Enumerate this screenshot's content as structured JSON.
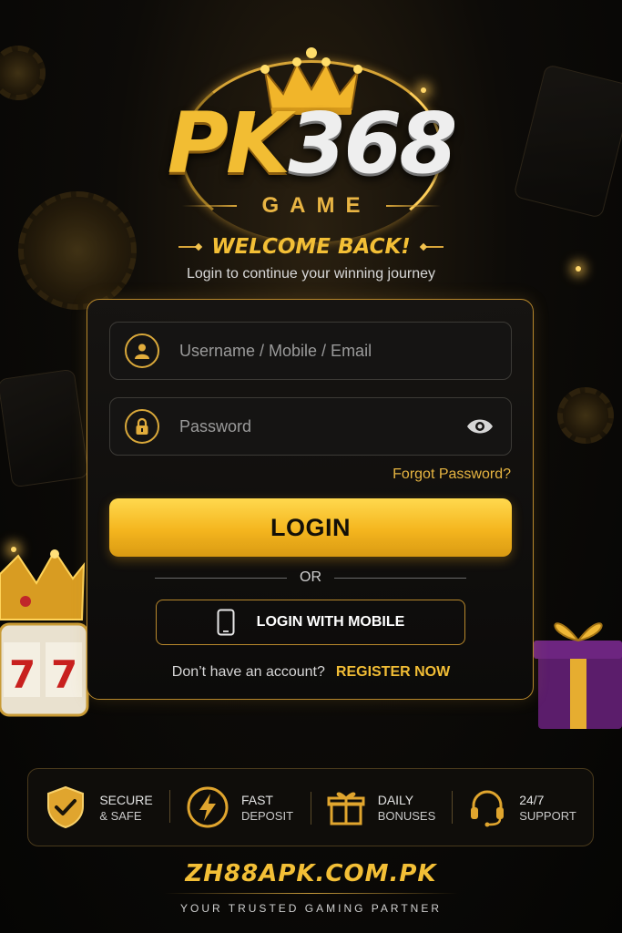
{
  "brand": {
    "logo_prefix": "PK",
    "logo_number": "368",
    "logo_sub": "GAME"
  },
  "welcome": {
    "title": "WELCOME BACK!",
    "subtitle": "Login to continue your winning journey"
  },
  "form": {
    "username_placeholder": "Username / Mobile / Email",
    "password_placeholder": "Password",
    "forgot_label": "Forgot Password?",
    "login_label": "LOGIN",
    "or_label": "OR",
    "mobile_login_label": "LOGIN WITH MOBILE",
    "no_account_text": "Don’t have an account?",
    "register_label": "REGISTER NOW"
  },
  "features": [
    {
      "icon": "shield-check-icon",
      "line1": "SECURE",
      "line2": "& SAFE"
    },
    {
      "icon": "lightning-icon",
      "line1": "FAST",
      "line2": "DEPOSIT"
    },
    {
      "icon": "gift-icon",
      "line1": "DAILY",
      "line2": "BONUSES"
    },
    {
      "icon": "headset-icon",
      "line1": "24/7",
      "line2": "SUPPORT"
    }
  ],
  "footer": {
    "domain": "ZH88APK.COM.PK",
    "tagline": "YOUR TRUSTED GAMING PARTNER"
  },
  "colors": {
    "gold": "#f3bf36",
    "background": "#0d0b08",
    "button_gold": "#f4b51e"
  }
}
